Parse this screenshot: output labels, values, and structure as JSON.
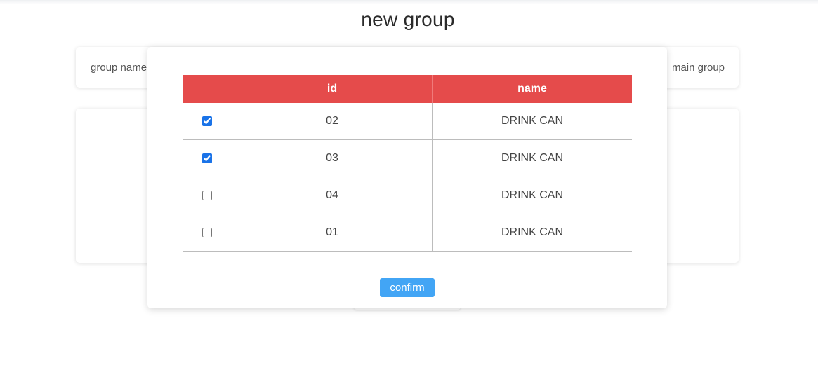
{
  "page": {
    "title": "new group"
  },
  "group_card": {
    "left_label": "group name",
    "right_label": "main group"
  },
  "modal": {
    "table": {
      "headers": [
        "",
        "id",
        "name"
      ],
      "rows": [
        {
          "checked": true,
          "id": "02",
          "name": "DRINK CAN"
        },
        {
          "checked": true,
          "id": "03",
          "name": "DRINK CAN"
        },
        {
          "checked": false,
          "id": "04",
          "name": "DRINK CAN"
        },
        {
          "checked": false,
          "id": "01",
          "name": "DRINK CAN"
        }
      ]
    },
    "confirm_label": "confirm"
  },
  "colors": {
    "table_header": "#e54b4b",
    "confirm_button": "#42a5f5",
    "checkbox_accent": "#1a73e8"
  }
}
